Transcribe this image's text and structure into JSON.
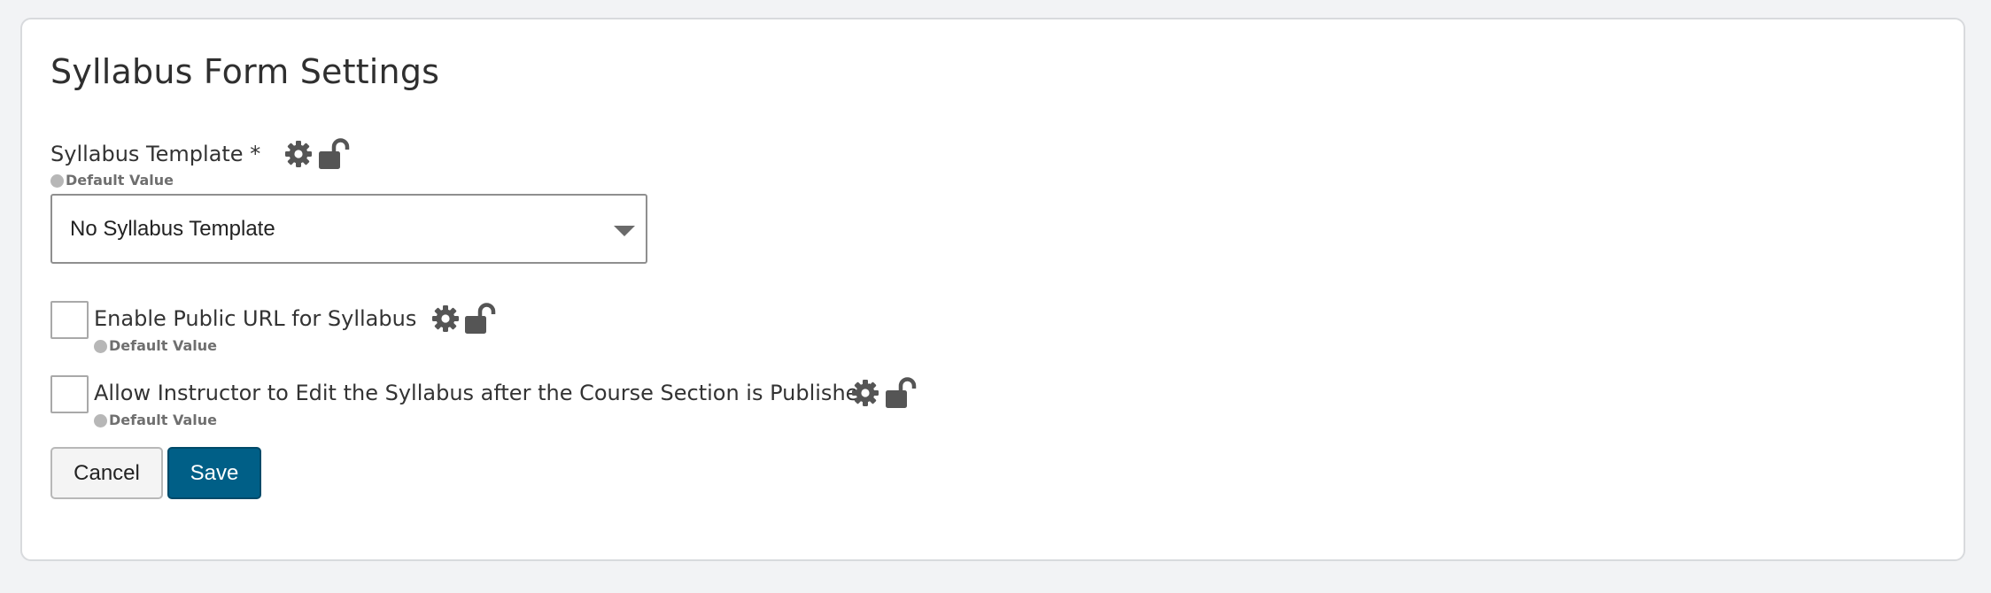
{
  "page": {
    "title": "Syllabus Form Settings"
  },
  "colors": {
    "background": "#f2f3f5",
    "card": "#ffffff",
    "icon": "#555555",
    "primary_button": "#005f87",
    "default_dot": "#b7b7b7"
  },
  "fields": {
    "syllabus_template": {
      "label": "Syllabus Template *",
      "default_label": "Default Value",
      "selected_value": "No Syllabus Template",
      "icons": [
        "gear-icon",
        "unlock-icon"
      ]
    },
    "public_url": {
      "label": "Enable Public URL for Syllabus",
      "default_label": "Default Value",
      "checked": false,
      "icons": [
        "gear-icon",
        "unlock-icon"
      ]
    },
    "instructor_edit": {
      "label": "Allow Instructor to Edit the Syllabus after the Course Section is Published",
      "default_label": "Default Value",
      "checked": false,
      "icons": [
        "gear-icon",
        "unlock-icon"
      ]
    }
  },
  "actions": {
    "cancel_label": "Cancel",
    "save_label": "Save"
  }
}
